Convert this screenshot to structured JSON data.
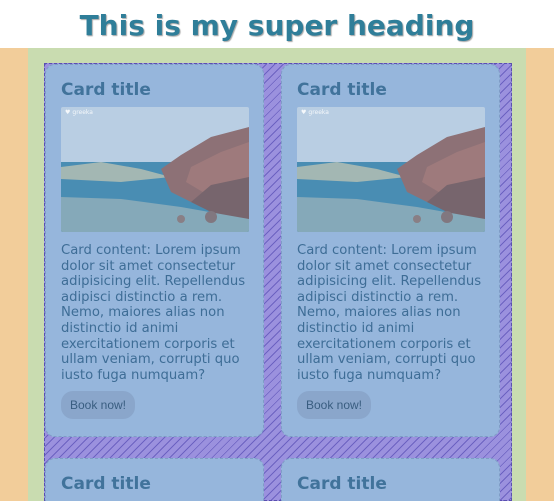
{
  "page": {
    "heading": "This is my super heading"
  },
  "cards": [
    {
      "title": "Card title",
      "content": "Card content: Lorem ipsum dolor sit amet consectetur adipisicing elit. Repellendus adipisci distinctio a rem. Nemo, maiores alias non distinctio id animi exercitationem corporis et ullam veniam, corrupti quo iusto fuga numquam?",
      "button": "Book now!",
      "image_watermark": "greeka"
    },
    {
      "title": "Card title",
      "content": "Card content: Lorem ipsum dolor sit amet consectetur adipisicing elit. Repellendus adipisci distinctio a rem. Nemo, maiores alias non distinctio id animi exercitationem corporis et ullam veniam, corrupti quo iusto fuga numquam?",
      "button": "Book now!",
      "image_watermark": "greeka"
    },
    {
      "title": "Card title"
    },
    {
      "title": "Card title"
    }
  ],
  "colors": {
    "heading": "#2f7e99",
    "outer_bg": "#f2cd9a",
    "middle_bg": "#c9dcb0",
    "grid_bg": "#9b91de",
    "card_bg": "#96b6dc",
    "card_text": "#3e6d96",
    "button_bg": "#8aa6cb"
  }
}
